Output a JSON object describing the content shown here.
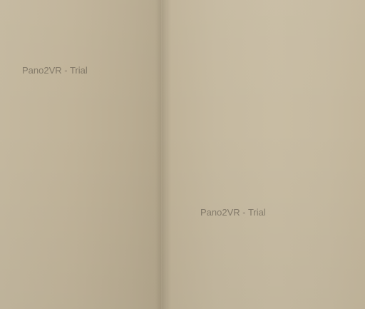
{
  "watermarks": [
    {
      "text": "Pano2VR - Trial"
    },
    {
      "text": "Pano2VR - Trial"
    }
  ],
  "colors": {
    "wall_left": "#c0b399",
    "wall_right": "#c6baa1",
    "watermark_text": "#6e6658"
  }
}
